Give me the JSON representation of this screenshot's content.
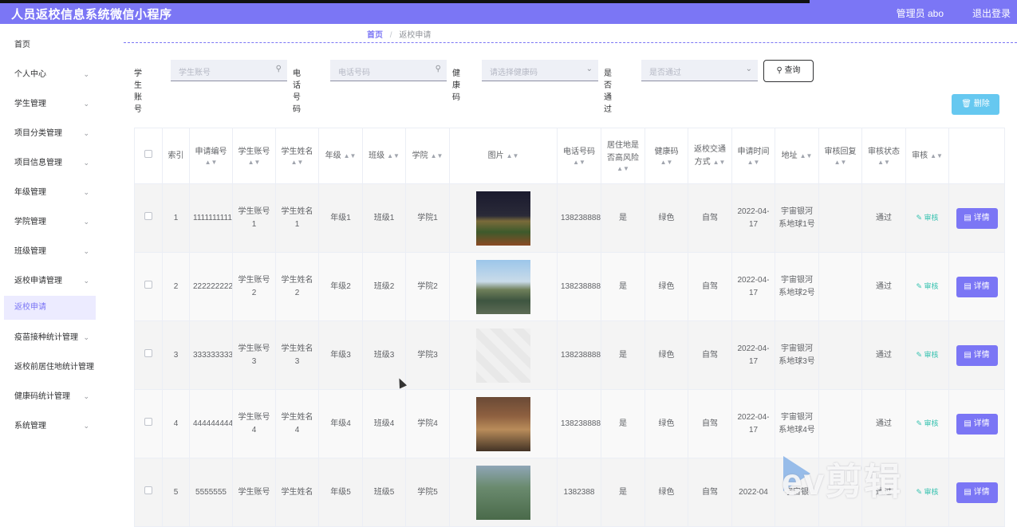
{
  "app": {
    "title": "人员返校信息系统微信小程序",
    "admin": "管理员 abo",
    "logout": "退出登录"
  },
  "sidebar": {
    "items": [
      {
        "label": "首页",
        "chevron": false
      },
      {
        "label": "个人中心",
        "chevron": true
      },
      {
        "label": "学生管理",
        "chevron": true
      },
      {
        "label": "项目分类管理",
        "chevron": true
      },
      {
        "label": "项目信息管理",
        "chevron": true
      },
      {
        "label": "年级管理",
        "chevron": true
      },
      {
        "label": "学院管理",
        "chevron": true
      },
      {
        "label": "班级管理",
        "chevron": true
      },
      {
        "label": "返校申请管理",
        "chevron": true
      }
    ],
    "active_sub": "返校申请",
    "items_after": [
      {
        "label": "疫苗接种统计管理",
        "chevron": true
      },
      {
        "label": "返校前居住地统计管理",
        "chevron": false
      },
      {
        "label": "健康码统计管理",
        "chevron": true
      },
      {
        "label": "系统管理",
        "chevron": true
      }
    ]
  },
  "breadcrumb": {
    "home": "首页",
    "separator": "/",
    "current": "返校申请"
  },
  "filters": {
    "student_account_label": "学生账号",
    "student_account_placeholder": "学生账号",
    "phone_label": "电话号码",
    "phone_placeholder": "电话号码",
    "health_code_label": "健康码",
    "health_code_placeholder": "请选择健康码",
    "passed_label": "是否通过",
    "passed_placeholder": "是否通过",
    "query_button": "查询"
  },
  "delete_button": "删除",
  "table": {
    "headers": {
      "index": "索引",
      "apply_no": "申请编号",
      "account": "学生账号",
      "name": "学生姓名",
      "grade": "年级",
      "class": "班级",
      "college": "学院",
      "image": "图片",
      "phone": "电话号码",
      "risk": "居住地是否高风险",
      "health": "健康码",
      "transport": "返校交通方式",
      "apply_time": "申请时间",
      "address": "地址",
      "reply": "审核回复",
      "status": "审核状态",
      "audit": "审核"
    },
    "rows": [
      {
        "index": "1",
        "apply_no": "1111111111",
        "account": "学生账号1",
        "name": "学生姓名1",
        "grade": "年级1",
        "class": "班级1",
        "college": "学院1",
        "phone": "13823888881",
        "risk": "是",
        "health": "绿色",
        "transport": "自驾",
        "apply_time": "2022-04-17",
        "address": "宇宙银河系地球1号",
        "reply": "",
        "status": "通过",
        "audit": "审核",
        "detail": "详情"
      },
      {
        "index": "2",
        "apply_no": "2222222222",
        "account": "学生账号2",
        "name": "学生姓名2",
        "grade": "年级2",
        "class": "班级2",
        "college": "学院2",
        "phone": "13823888882",
        "risk": "是",
        "health": "绿色",
        "transport": "自驾",
        "apply_time": "2022-04-17",
        "address": "宇宙银河系地球2号",
        "reply": "",
        "status": "通过",
        "audit": "审核",
        "detail": "详情"
      },
      {
        "index": "3",
        "apply_no": "3333333333",
        "account": "学生账号3",
        "name": "学生姓名3",
        "grade": "年级3",
        "class": "班级3",
        "college": "学院3",
        "phone": "13823888883",
        "risk": "是",
        "health": "绿色",
        "transport": "自驾",
        "apply_time": "2022-04-17",
        "address": "宇宙银河系地球3号",
        "reply": "",
        "status": "通过",
        "audit": "审核",
        "detail": "详情"
      },
      {
        "index": "4",
        "apply_no": "4444444444",
        "account": "学生账号4",
        "name": "学生姓名4",
        "grade": "年级4",
        "class": "班级4",
        "college": "学院4",
        "phone": "13823888884",
        "risk": "是",
        "health": "绿色",
        "transport": "自驾",
        "apply_time": "2022-04-17",
        "address": "宇宙银河系地球4号",
        "reply": "",
        "status": "通过",
        "audit": "审核",
        "detail": "详情"
      },
      {
        "index": "5",
        "apply_no": "5555555",
        "account": "学生账号",
        "name": "学生姓名",
        "grade": "年级5",
        "class": "班级5",
        "college": "学院5",
        "phone": "1382388",
        "risk": "是",
        "health": "绿色",
        "transport": "自驾",
        "apply_time": "2022-04",
        "address": "宇宙银",
        "reply": "",
        "status": "通过",
        "audit": "审核",
        "detail": "详情"
      }
    ]
  },
  "watermark": "ev剪辑"
}
